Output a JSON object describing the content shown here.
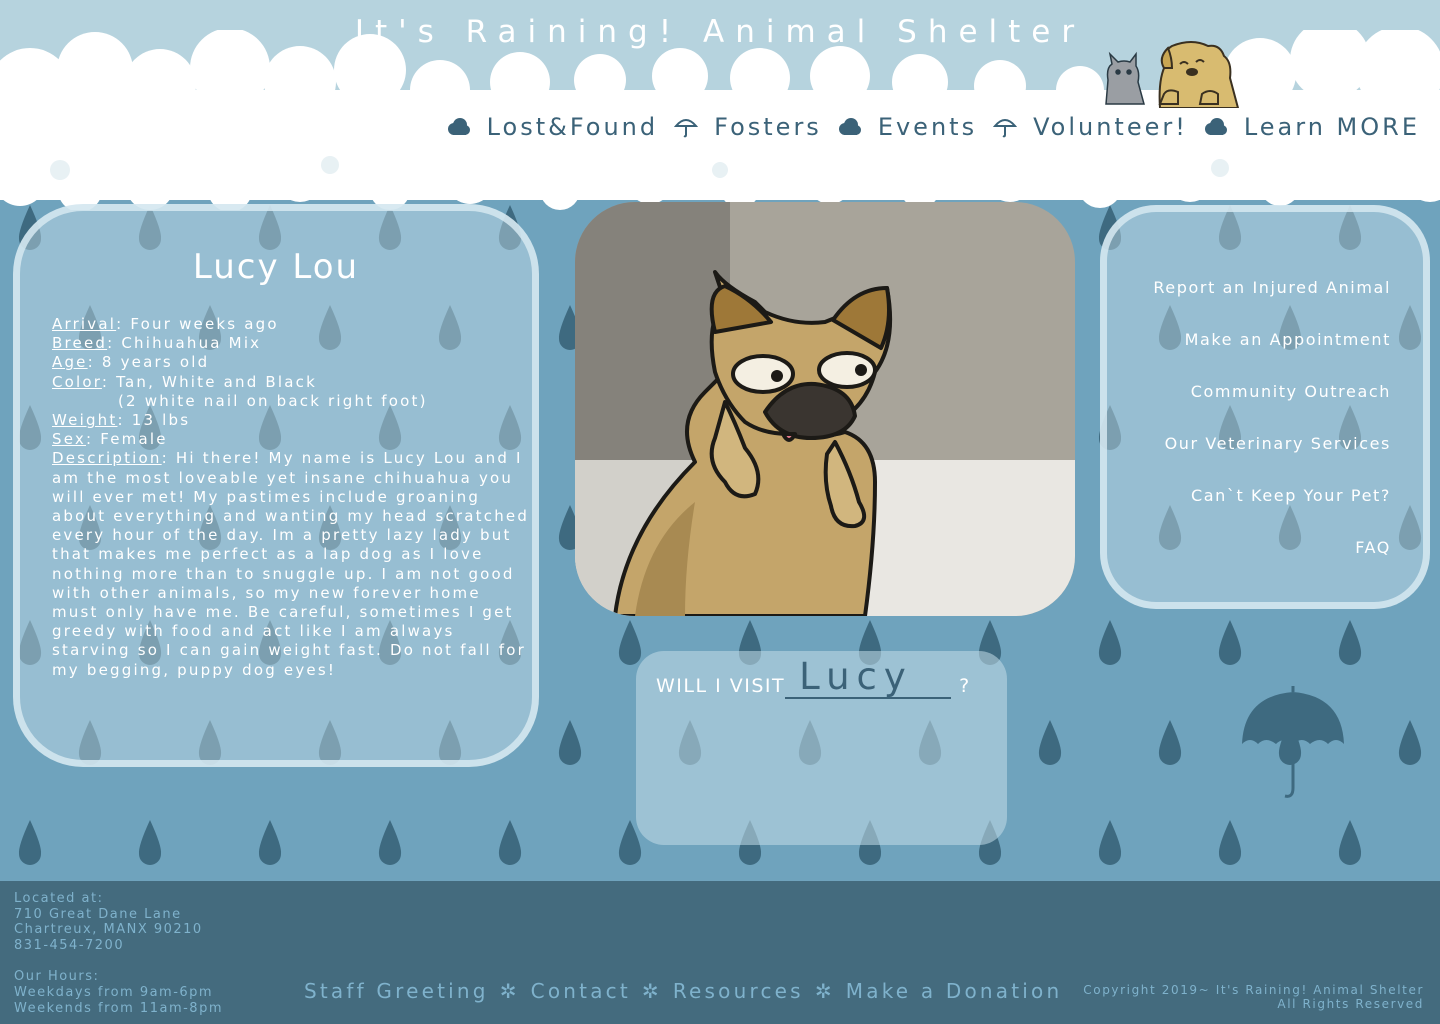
{
  "site": {
    "title": "It's Raining! Animal Shelter"
  },
  "nav": {
    "items": [
      "Lost&Found",
      "Fosters",
      "Events",
      "Volunteer!",
      "Learn MORE"
    ],
    "separators": [
      "cloud-icon",
      "umbrella-icon",
      "cloud-icon",
      "umbrella-icon",
      "cloud-icon"
    ]
  },
  "profile": {
    "name": "Lucy Lou",
    "arrival_label": "Arrival",
    "arrival": "Four weeks ago",
    "breed_label": "Breed",
    "breed": "Chihuahua Mix",
    "age_label": "Age",
    "age": "8 years old",
    "color_label": "Color",
    "color": "Tan, White and Black",
    "color_note": "(2 white nail on back right foot)",
    "weight_label": "Weight",
    "weight": "13 lbs",
    "sex_label": "Sex",
    "sex": "Female",
    "description_label": "Description",
    "description": "Hi there! My name is Lucy Lou and I am the most loveable yet insane chihuahua you will ever met! My pastimes include groaning about everything and wanting my head scratched every hour of the day. Im a pretty lazy lady but that makes me perfect as a lap dog as I love nothing more than to snuggle up. I am not good with other animals, so my new forever home must only have me. Be careful, sometimes I get greedy with food and act like I am always starving so I can gain weight fast. Do not fall for my begging, puppy dog eyes!"
  },
  "side_links": [
    "Report an Injured Animal",
    "Make an Appointment",
    "Community Outreach",
    "Our Veterinary Services",
    "Can`t Keep Your Pet?",
    "FAQ"
  ],
  "visit": {
    "prefix": "WILL I VISIT",
    "name": "Lucy",
    "suffix": "?"
  },
  "footer": {
    "located_label": "Located at:",
    "address_line1": "710 Great Dane Lane",
    "address_line2": "Chartreux, MANX 90210",
    "phone": "831-454-7200",
    "hours_label": "Our Hours:",
    "weekdays": "Weekdays from 9am-6pm",
    "weekends": "Weekends from 11am-8pm",
    "links": [
      "Staff Greeting",
      "Contact",
      "Resources",
      "Make a Donation"
    ],
    "copyright_line1": "Copyright 2019~ It's Raining! Animal Shelter",
    "copyright_line2": "All Rights Reserved"
  },
  "colors": {
    "sky": "#b6d3de",
    "rain_background": "#6fa3bd",
    "raindrop": "#3e6a80",
    "nav_text": "#3b6278",
    "footer_bg": "#446b7e",
    "footer_text": "#7fb2cc"
  }
}
